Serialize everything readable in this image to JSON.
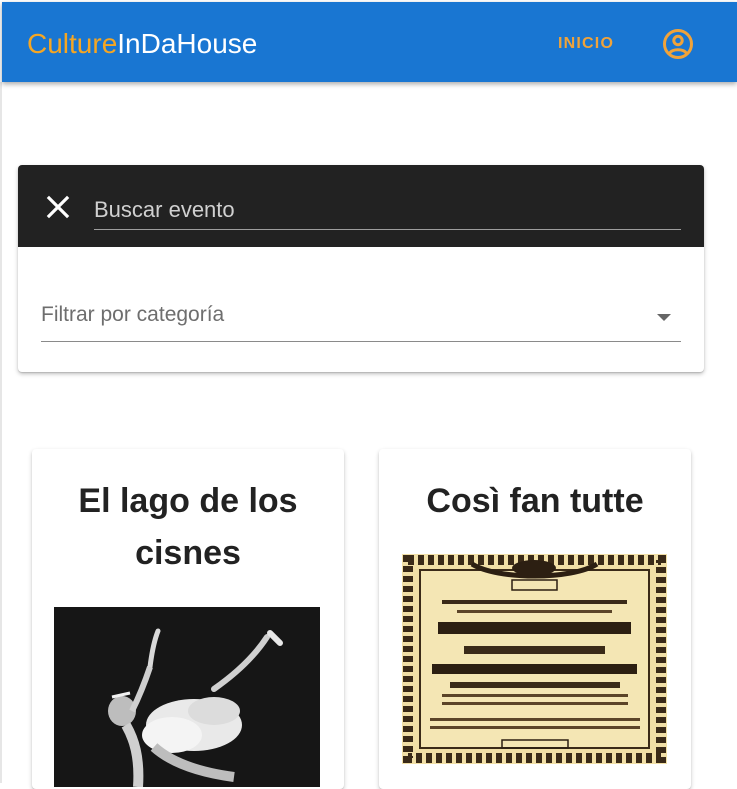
{
  "header": {
    "brand_accent": "Culture",
    "brand_rest": "InDaHouse",
    "nav_inicio": "INICIO",
    "account_icon": "account-circle-icon",
    "colors": {
      "bar": "#1976d2",
      "accent": "#f5a623"
    }
  },
  "search": {
    "placeholder": "Buscar evento",
    "close_icon": "close-icon",
    "bar_color": "#222222"
  },
  "filter": {
    "label": "Filtrar por categoría",
    "caret_icon": "arrow-drop-down-icon"
  },
  "events": [
    {
      "title": "El lago de los cisnes",
      "image": "ballet-dancer-photo"
    },
    {
      "title": "Così fan tutte",
      "image": "vintage-opera-poster"
    }
  ]
}
